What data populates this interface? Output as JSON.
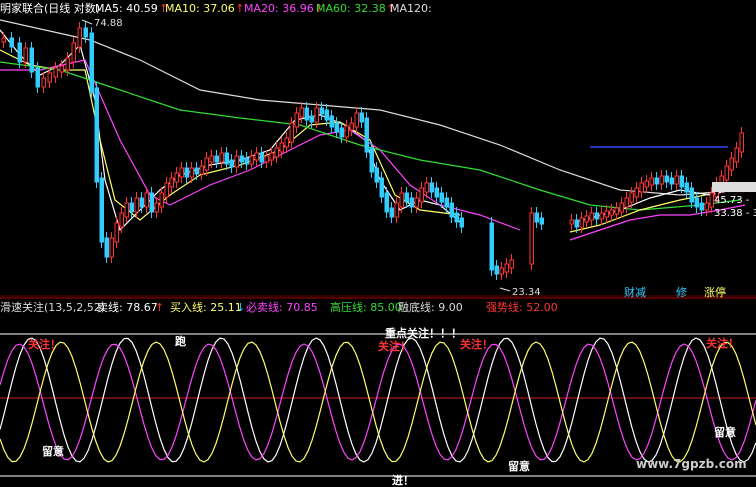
{
  "header": {
    "title": "明家联合(日线 对数)",
    "ma_labels": [
      "MA5: 40.59",
      "MA10: 37.06",
      "MA20: 36.96",
      "MA60: 32.38",
      "MA120:"
    ],
    "ma_colors": [
      "#ffffff",
      "#ffff66",
      "#ff44ff",
      "#33dd33",
      "#dddddd"
    ],
    "arrow": "↑"
  },
  "price_labels": {
    "high": "74.88",
    "low": "23.34",
    "right1": "45.73 -",
    "right2": "33.38 - 3"
  },
  "badges": {
    "cai": "财减",
    "xiu": "修",
    "zhang": "涨停"
  },
  "indicator": {
    "name": "滑速关注(13,5,2,52)",
    "labels": [
      {
        "text": "卖线: 78.67",
        "color": "#ffffff"
      },
      {
        "text": "买入线: 25.11",
        "color": "#ffff66"
      },
      {
        "text": "必卖线: 70.85",
        "color": "#ff44ff"
      },
      {
        "text": "高压线: 85.00",
        "color": "#33dd33"
      },
      {
        "text": "融底线: 9.00",
        "color": "#dddddd"
      },
      {
        "text": "强势线: 52.00",
        "color": "#ff3333"
      }
    ],
    "sell_arrow": "↑",
    "buy_arrow": "↓",
    "annotations": {
      "focus": "重点关注！！！",
      "gz1": "关注！",
      "gz2": "关注！",
      "gz3": "关注！",
      "gz4": "关注！",
      "pao": "跑",
      "liuyi1": "留意",
      "liuyi2": "留意",
      "liuyi3": "留意",
      "jin": "进！"
    }
  },
  "watermark": "www.7gpzb.com",
  "colors": {
    "bg": "#000000",
    "up": "#ff3333",
    "down": "#33ccff",
    "grid": "#aa0000"
  },
  "chart_data": [
    {
      "type": "candlestick",
      "title": "明家联合(日线 对数)",
      "series": [
        {
          "name": "MA5",
          "values": [
            40.59
          ]
        },
        {
          "name": "MA10",
          "values": [
            37.06
          ]
        },
        {
          "name": "MA20",
          "values": [
            36.96
          ]
        },
        {
          "name": "MA60",
          "values": [
            32.38
          ]
        },
        {
          "name": "MA120",
          "values": []
        }
      ],
      "annotations": [
        "74.88",
        "23.34",
        "45.73",
        "33.38"
      ]
    },
    {
      "type": "line",
      "title": "滑速关注(13,5,2,52)",
      "series": [
        {
          "name": "卖线",
          "values": [
            78.67
          ]
        },
        {
          "name": "买入线",
          "values": [
            25.11
          ]
        },
        {
          "name": "必卖线",
          "values": [
            70.85
          ]
        },
        {
          "name": "高压线",
          "values": [
            85.0
          ]
        },
        {
          "name": "融底线",
          "values": [
            9.0
          ]
        },
        {
          "name": "强势线",
          "values": [
            52.0
          ]
        }
      ]
    }
  ]
}
